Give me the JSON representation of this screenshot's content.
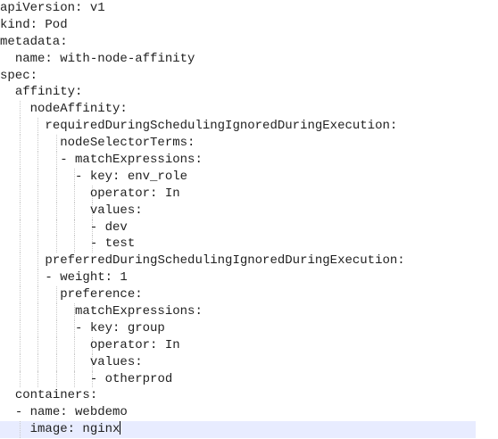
{
  "editor": {
    "language": "yaml",
    "current_line": 25,
    "lines": [
      {
        "indent": 0,
        "text": "apiVersion: v1"
      },
      {
        "indent": 0,
        "text": "kind: Pod"
      },
      {
        "indent": 0,
        "text": "metadata:"
      },
      {
        "indent": 2,
        "text": "name: with-node-affinity"
      },
      {
        "indent": 0,
        "text": "spec:"
      },
      {
        "indent": 2,
        "text": "affinity:"
      },
      {
        "indent": 4,
        "text": "nodeAffinity:"
      },
      {
        "indent": 6,
        "text": "requiredDuringSchedulingIgnoredDuringExecution:"
      },
      {
        "indent": 8,
        "text": "nodeSelectorTerms:"
      },
      {
        "indent": 8,
        "text": "- matchExpressions:"
      },
      {
        "indent": 10,
        "text": "- key: env_role"
      },
      {
        "indent": 12,
        "text": "operator: In"
      },
      {
        "indent": 12,
        "text": "values:"
      },
      {
        "indent": 12,
        "text": "- dev"
      },
      {
        "indent": 12,
        "text": "- test"
      },
      {
        "indent": 6,
        "text": "preferredDuringSchedulingIgnoredDuringExecution:"
      },
      {
        "indent": 6,
        "text": "- weight: 1"
      },
      {
        "indent": 8,
        "text": "preference:"
      },
      {
        "indent": 10,
        "text": "matchExpressions:"
      },
      {
        "indent": 10,
        "text": "- key: group"
      },
      {
        "indent": 12,
        "text": "operator: In"
      },
      {
        "indent": 12,
        "text": "values:"
      },
      {
        "indent": 12,
        "text": "- otherprod"
      },
      {
        "indent": 2,
        "text": "containers:"
      },
      {
        "indent": 2,
        "text": "- name: webdemo"
      },
      {
        "indent": 4,
        "text": "image: nginx"
      }
    ]
  }
}
